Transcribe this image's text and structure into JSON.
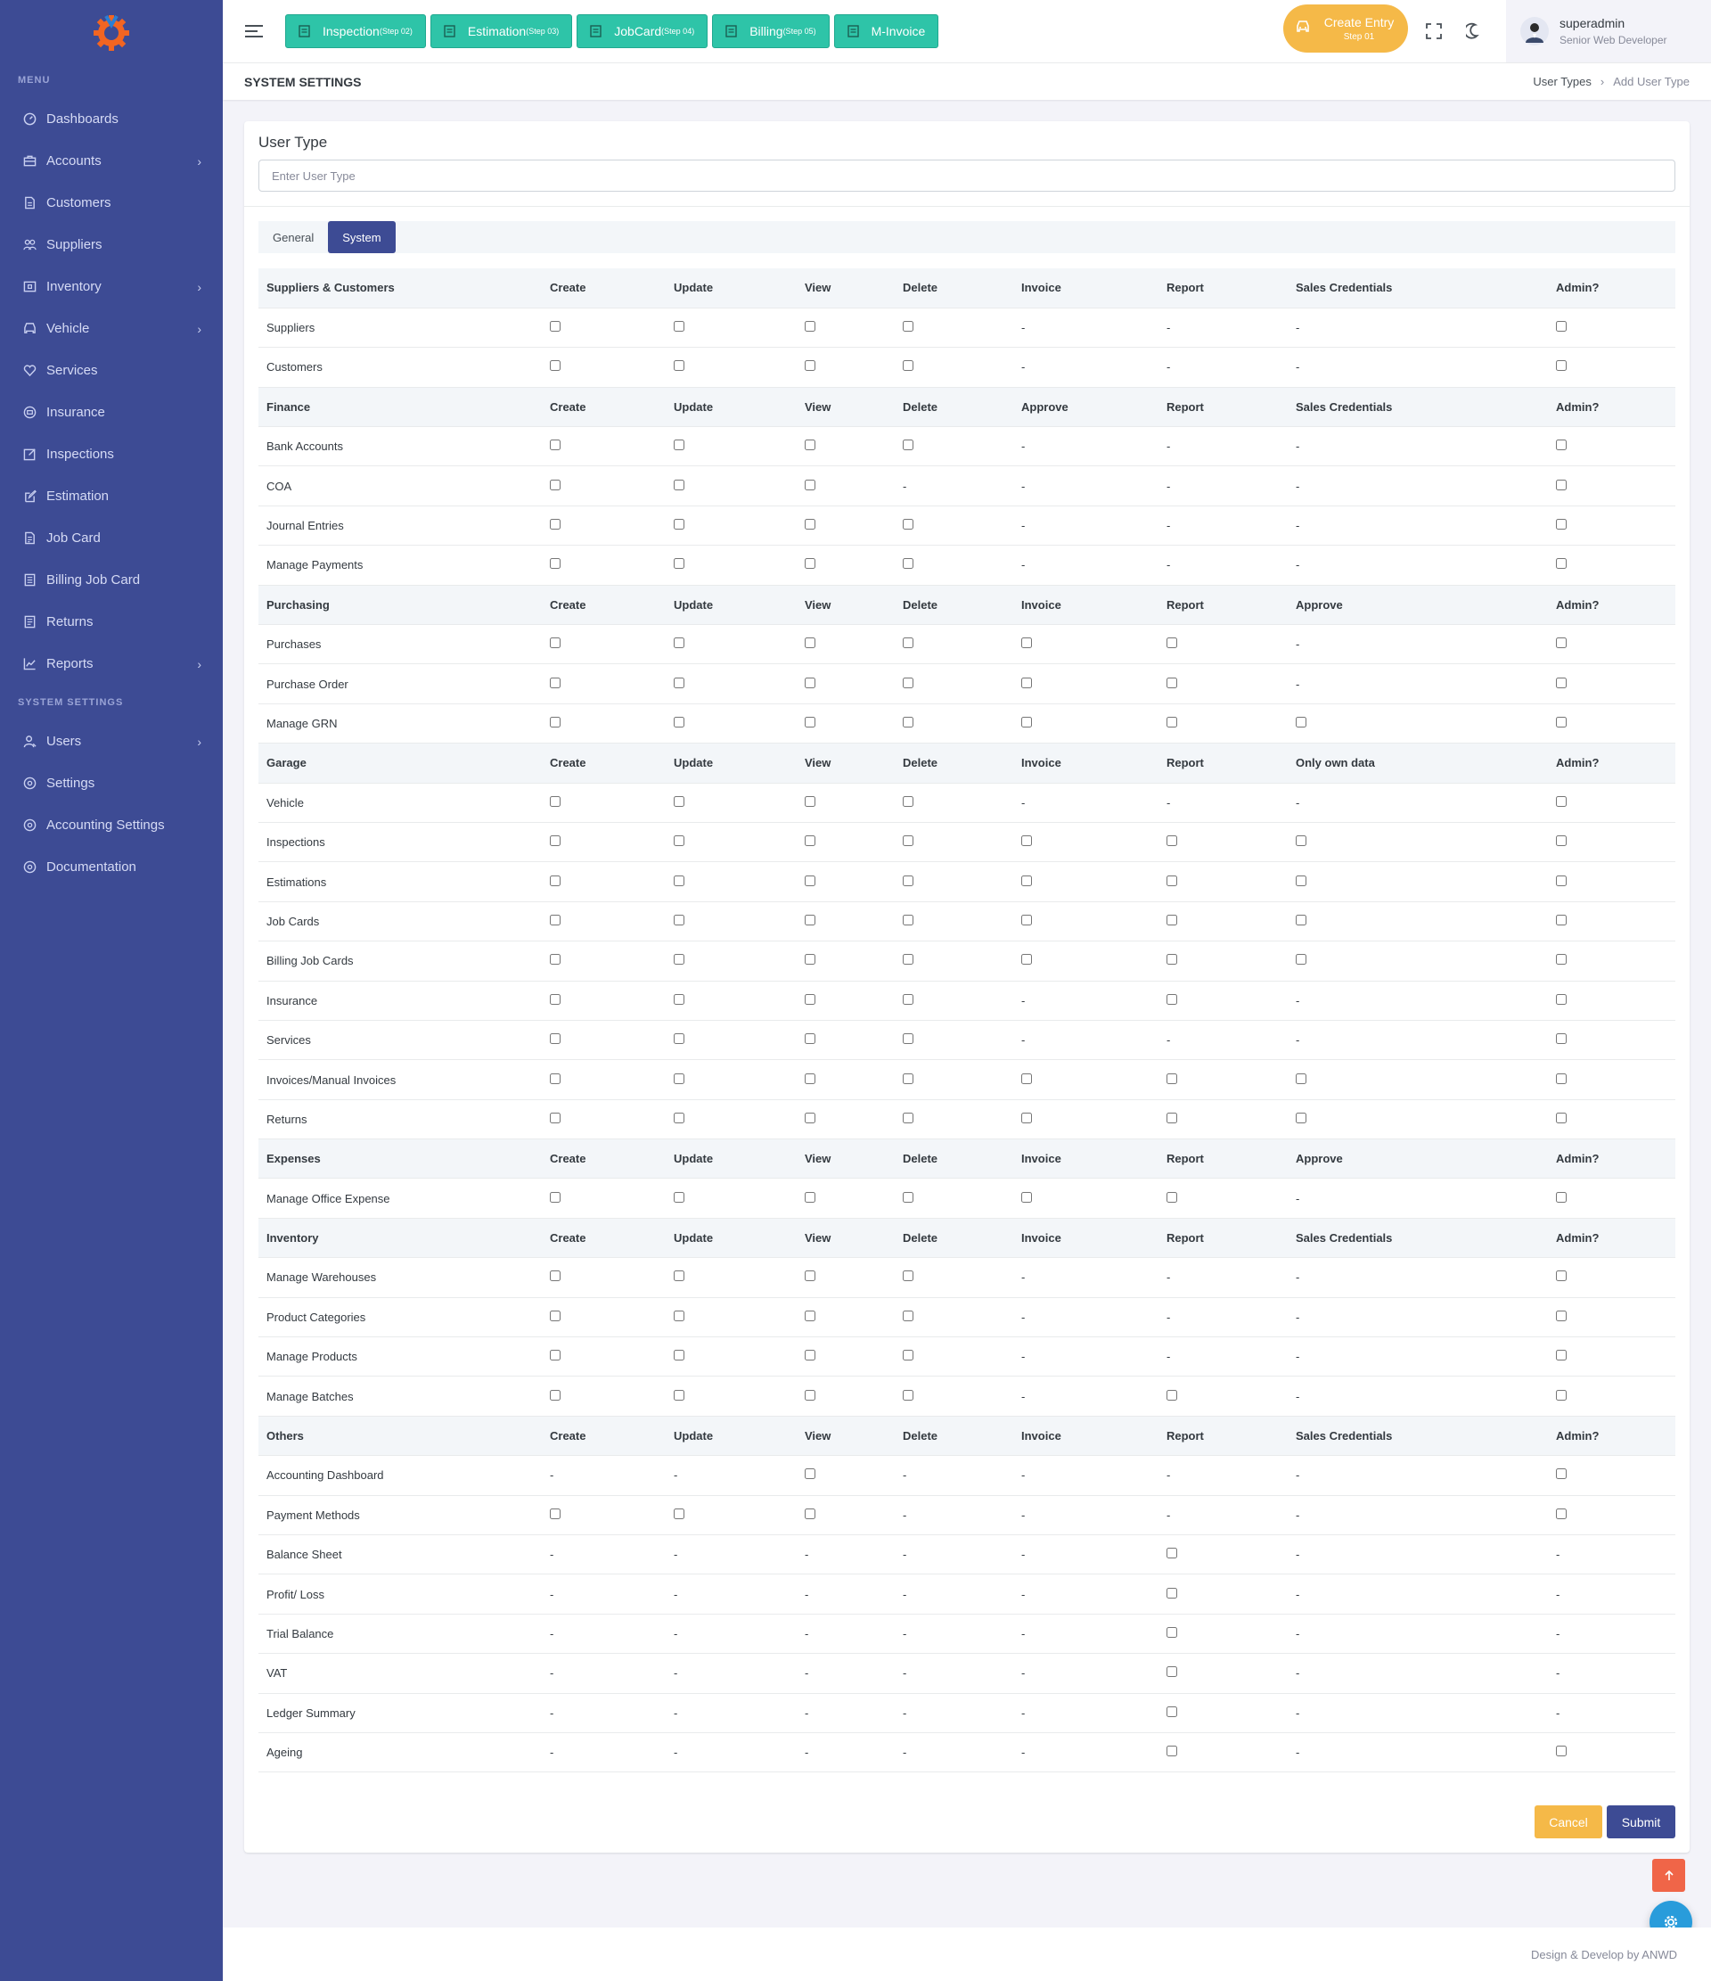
{
  "sidebar": {
    "menu_title": "MENU",
    "items": [
      {
        "label": "Dashboards",
        "icon": "dashboard-icon",
        "chevron": false
      },
      {
        "label": "Accounts",
        "icon": "briefcase-icon",
        "chevron": true
      },
      {
        "label": "Customers",
        "icon": "document-icon",
        "chevron": false
      },
      {
        "label": "Suppliers",
        "icon": "people-icon",
        "chevron": false
      },
      {
        "label": "Inventory",
        "icon": "box-icon",
        "chevron": true
      },
      {
        "label": "Vehicle",
        "icon": "car-icon",
        "chevron": true
      },
      {
        "label": "Services",
        "icon": "heart-icon",
        "chevron": false
      },
      {
        "label": "Insurance",
        "icon": "shield-icon",
        "chevron": false
      },
      {
        "label": "Inspections",
        "icon": "edit-box-icon",
        "chevron": false
      },
      {
        "label": "Estimation",
        "icon": "edit-icon",
        "chevron": false
      },
      {
        "label": "Job Card",
        "icon": "file-icon",
        "chevron": false
      },
      {
        "label": "Billing Job Card",
        "icon": "file-list-icon",
        "chevron": false
      },
      {
        "label": "Returns",
        "icon": "list-icon",
        "chevron": false
      },
      {
        "label": "Reports",
        "icon": "chart-line-icon",
        "chevron": true
      }
    ],
    "settings_title": "SYSTEM SETTINGS",
    "settings_items": [
      {
        "label": "Users",
        "icon": "user-icon",
        "chevron": true
      },
      {
        "label": "Settings",
        "icon": "settings-icon",
        "chevron": false
      },
      {
        "label": "Accounting Settings",
        "icon": "settings-icon",
        "chevron": false
      },
      {
        "label": "Documentation",
        "icon": "settings-icon",
        "chevron": false
      }
    ]
  },
  "topbar": {
    "steps": [
      {
        "label": "Inspection",
        "step": "(Step 02)"
      },
      {
        "label": "Estimation",
        "step": "(Step 03)"
      },
      {
        "label": "JobCard",
        "step": "(Step 04)"
      },
      {
        "label": "Billing",
        "step": "(Step 05)"
      },
      {
        "label": "M-Invoice",
        "step": ""
      }
    ],
    "create_entry": {
      "label": "Create Entry",
      "step": "Step 01"
    },
    "user": {
      "name": "superadmin",
      "role": "Senior Web Developer"
    }
  },
  "page": {
    "title": "SYSTEM SETTINGS",
    "breadcrumb": [
      "User Types",
      "Add User Type"
    ]
  },
  "form": {
    "field_label": "User Type",
    "placeholder": "Enter User Type",
    "value": "",
    "tabs": [
      {
        "label": "General",
        "active": false
      },
      {
        "label": "System",
        "active": true
      }
    ],
    "cancel_label": "Cancel",
    "submit_label": "Submit"
  },
  "permissions": [
    {
      "headers": [
        "Suppliers & Customers",
        "Create",
        "Update",
        "View",
        "Delete",
        "Invoice",
        "Report",
        "Sales Credentials",
        "Admin?"
      ],
      "rows": [
        {
          "name": "Suppliers",
          "cells": [
            "c",
            "c",
            "c",
            "c",
            "-",
            "-",
            "-",
            "c"
          ]
        },
        {
          "name": "Customers",
          "cells": [
            "c",
            "c",
            "c",
            "c",
            "-",
            "-",
            "-",
            "c"
          ]
        }
      ]
    },
    {
      "headers": [
        "Finance",
        "Create",
        "Update",
        "View",
        "Delete",
        "Approve",
        "Report",
        "Sales Credentials",
        "Admin?"
      ],
      "rows": [
        {
          "name": "Bank Accounts",
          "cells": [
            "c",
            "c",
            "c",
            "c",
            "-",
            "-",
            "-",
            "c"
          ]
        },
        {
          "name": "COA",
          "cells": [
            "c",
            "c",
            "c",
            "-",
            "-",
            "-",
            "-",
            "c"
          ]
        },
        {
          "name": "Journal Entries",
          "cells": [
            "c",
            "c",
            "c",
            "c",
            "-",
            "-",
            "-",
            "c"
          ]
        },
        {
          "name": "Manage Payments",
          "cells": [
            "c",
            "c",
            "c",
            "c",
            "-",
            "-",
            "-",
            "c"
          ]
        }
      ]
    },
    {
      "headers": [
        "Purchasing",
        "Create",
        "Update",
        "View",
        "Delete",
        "Invoice",
        "Report",
        "Approve",
        "Admin?"
      ],
      "rows": [
        {
          "name": "Purchases",
          "cells": [
            "c",
            "c",
            "c",
            "c",
            "c",
            "c",
            "-",
            "c"
          ]
        },
        {
          "name": "Purchase Order",
          "cells": [
            "c",
            "c",
            "c",
            "c",
            "c",
            "c",
            "-",
            "c"
          ]
        },
        {
          "name": "Manage GRN",
          "cells": [
            "c",
            "c",
            "c",
            "c",
            "c",
            "c",
            "c",
            "c"
          ]
        }
      ]
    },
    {
      "headers": [
        "Garage",
        "Create",
        "Update",
        "View",
        "Delete",
        "Invoice",
        "Report",
        "Only own data",
        "Admin?"
      ],
      "rows": [
        {
          "name": "Vehicle",
          "cells": [
            "c",
            "c",
            "c",
            "c",
            "-",
            "-",
            "-",
            "c"
          ]
        },
        {
          "name": "Inspections",
          "cells": [
            "c",
            "c",
            "c",
            "c",
            "c",
            "c",
            "c",
            "c"
          ]
        },
        {
          "name": "Estimations",
          "cells": [
            "c",
            "c",
            "c",
            "c",
            "c",
            "c",
            "c",
            "c"
          ]
        },
        {
          "name": "Job Cards",
          "cells": [
            "c",
            "c",
            "c",
            "c",
            "c",
            "c",
            "c",
            "c"
          ]
        },
        {
          "name": "Billing Job Cards",
          "cells": [
            "c",
            "c",
            "c",
            "c",
            "c",
            "c",
            "c",
            "c"
          ]
        },
        {
          "name": "Insurance",
          "cells": [
            "c",
            "c",
            "c",
            "c",
            "-",
            "c",
            "-",
            "c"
          ]
        },
        {
          "name": "Services",
          "cells": [
            "c",
            "c",
            "c",
            "c",
            "-",
            "-",
            "-",
            "c"
          ]
        },
        {
          "name": "Invoices/Manual Invoices",
          "cells": [
            "c",
            "c",
            "c",
            "c",
            "c",
            "c",
            "c",
            "c"
          ]
        },
        {
          "name": "Returns",
          "cells": [
            "c",
            "c",
            "c",
            "c",
            "c",
            "c",
            "c",
            "c"
          ]
        }
      ]
    },
    {
      "headers": [
        "Expenses",
        "Create",
        "Update",
        "View",
        "Delete",
        "Invoice",
        "Report",
        "Approve",
        "Admin?"
      ],
      "rows": [
        {
          "name": "Manage Office Expense",
          "cells": [
            "c",
            "c",
            "c",
            "c",
            "c",
            "c",
            "-",
            "c"
          ]
        }
      ]
    },
    {
      "headers": [
        "Inventory",
        "Create",
        "Update",
        "View",
        "Delete",
        "Invoice",
        "Report",
        "Sales Credentials",
        "Admin?"
      ],
      "rows": [
        {
          "name": "Manage Warehouses",
          "cells": [
            "c",
            "c",
            "c",
            "c",
            "-",
            "-",
            "-",
            "c"
          ]
        },
        {
          "name": "Product Categories",
          "cells": [
            "c",
            "c",
            "c",
            "c",
            "-",
            "-",
            "-",
            "c"
          ]
        },
        {
          "name": "Manage Products",
          "cells": [
            "c",
            "c",
            "c",
            "c",
            "-",
            "-",
            "-",
            "c"
          ]
        },
        {
          "name": "Manage Batches",
          "cells": [
            "c",
            "c",
            "c",
            "c",
            "-",
            "c",
            "-",
            "c"
          ]
        }
      ]
    },
    {
      "headers": [
        "Others",
        "Create",
        "Update",
        "View",
        "Delete",
        "Invoice",
        "Report",
        "Sales Credentials",
        "Admin?"
      ],
      "rows": [
        {
          "name": "Accounting Dashboard",
          "cells": [
            "-",
            "-",
            "c",
            "-",
            "-",
            "-",
            "-",
            "c"
          ]
        },
        {
          "name": "Payment Methods",
          "cells": [
            "c",
            "c",
            "c",
            "-",
            "-",
            "-",
            "-",
            "c"
          ]
        },
        {
          "name": "Balance Sheet",
          "cells": [
            "-",
            "-",
            "-",
            "-",
            "-",
            "c",
            "-",
            "-"
          ]
        },
        {
          "name": "Profit/ Loss",
          "cells": [
            "-",
            "-",
            "-",
            "-",
            "-",
            "c",
            "-",
            "-"
          ]
        },
        {
          "name": "Trial Balance",
          "cells": [
            "-",
            "-",
            "-",
            "-",
            "-",
            "c",
            "-",
            "-"
          ]
        },
        {
          "name": "VAT",
          "cells": [
            "-",
            "-",
            "-",
            "-",
            "-",
            "c",
            "-",
            "-"
          ]
        },
        {
          "name": "Ledger Summary",
          "cells": [
            "-",
            "-",
            "-",
            "-",
            "-",
            "c",
            "-",
            "-"
          ]
        },
        {
          "name": "Ageing",
          "cells": [
            "-",
            "-",
            "-",
            "-",
            "-",
            "c",
            "-",
            "c"
          ]
        }
      ]
    }
  ],
  "footer": {
    "text": "Design & Develop by ANWD"
  },
  "colors": {
    "sidebar": "#3d4b94",
    "accent_green": "#2ec4a8",
    "accent_orange": "#f5b948",
    "danger": "#f06548",
    "info": "#299cdb"
  }
}
